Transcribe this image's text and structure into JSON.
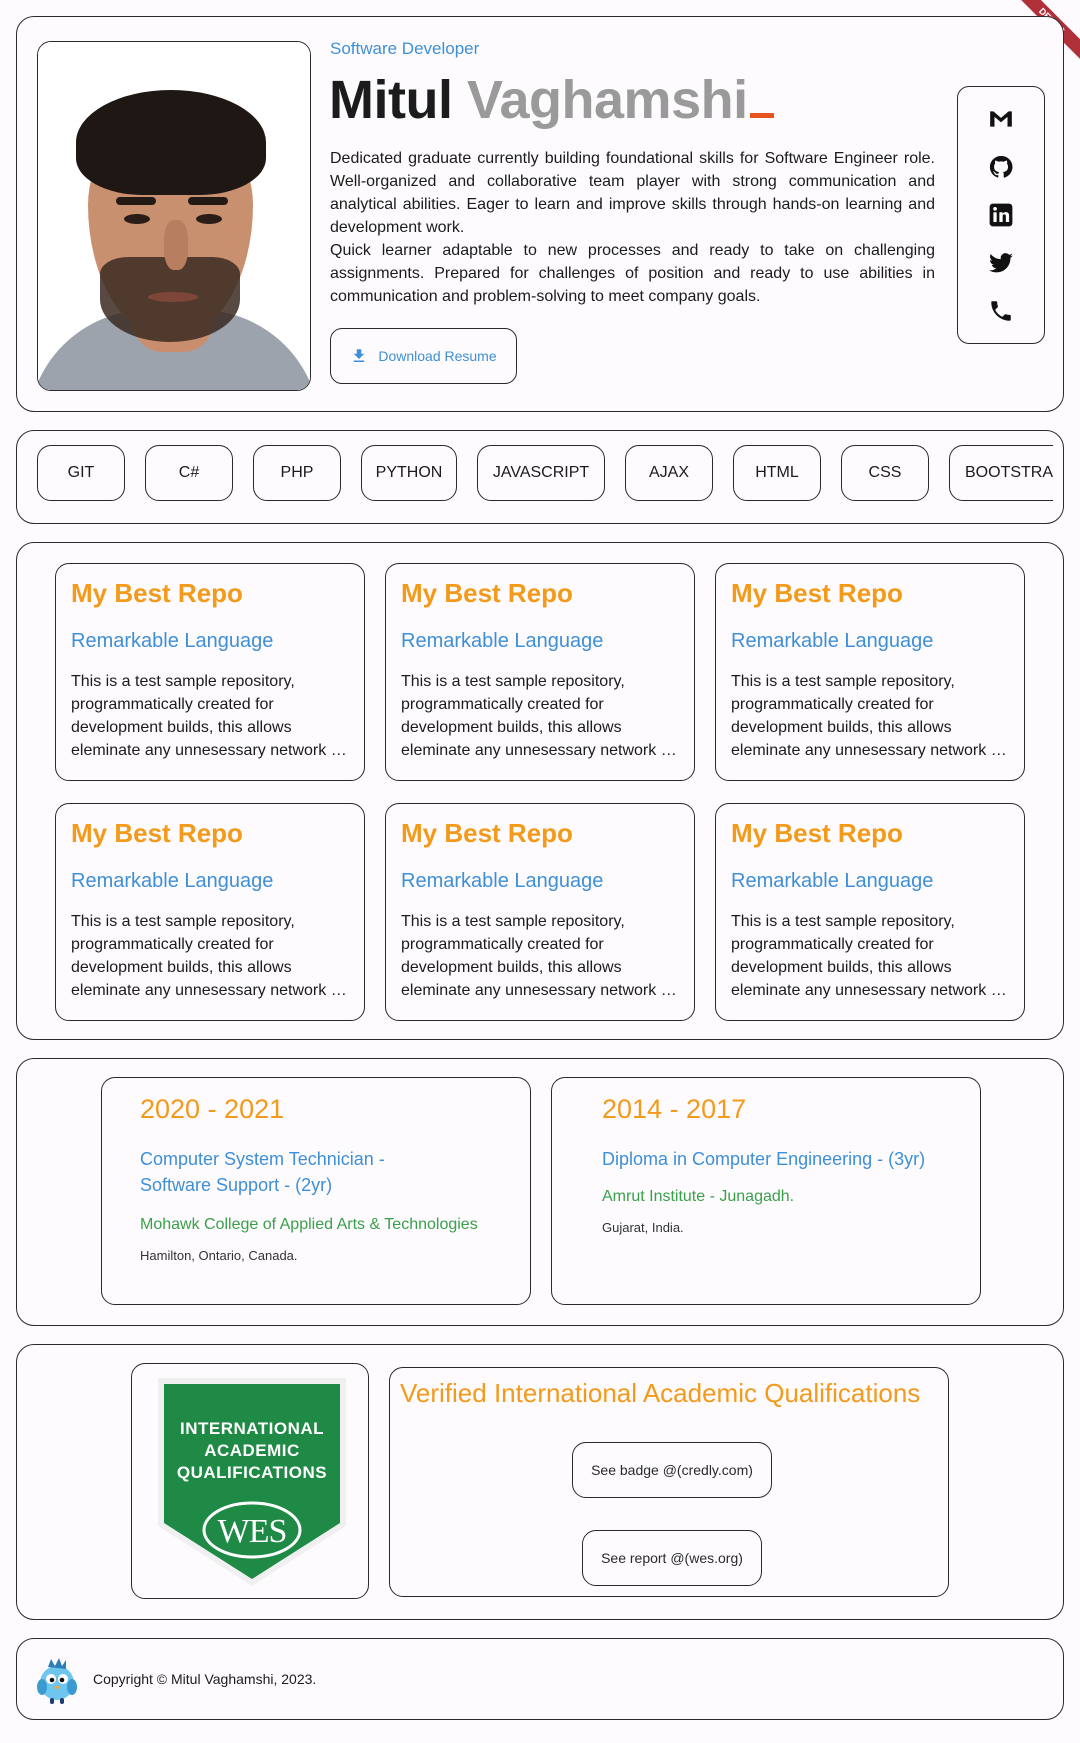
{
  "debug_banner": "DEBUG",
  "hero": {
    "role": "Software Developer",
    "first_name": "Mitul",
    "last_name": "Vaghamshi",
    "bio_1": "Dedicated graduate currently building foundational skills for Software Engineer role. Well-organized and collaborative team player with strong communication and analytical abilities. Eager to learn and improve skills through hands-on learning and development work.",
    "bio_2": "Quick learner adaptable to new processes and ready to take on challenging assignments. Prepared for challenges of position and ready to use abilities in communication and problem-solving to meet company goals.",
    "download_label": "Download Resume"
  },
  "social": [
    {
      "icon": "gmail-icon"
    },
    {
      "icon": "github-icon"
    },
    {
      "icon": "linkedin-icon"
    },
    {
      "icon": "twitter-icon"
    },
    {
      "icon": "phone-icon"
    }
  ],
  "skills": [
    "GIT",
    "C#",
    "PHP",
    "PYTHON",
    "JAVASCRIPT",
    "AJAX",
    "HTML",
    "CSS",
    "BOOTSTRAP"
  ],
  "repos": [
    {
      "title": "My Best Repo",
      "language": "Remarkable Language",
      "description": "This is a test sample repository, programmatically created for development builds, this allows eleminate any unnesessary network …"
    },
    {
      "title": "My Best Repo",
      "language": "Remarkable Language",
      "description": "This is a test sample repository, programmatically created for development builds, this allows eleminate any unnesessary network …"
    },
    {
      "title": "My Best Repo",
      "language": "Remarkable Language",
      "description": "This is a test sample repository, programmatically created for development builds, this allows eleminate any unnesessary network …"
    },
    {
      "title": "My Best Repo",
      "language": "Remarkable Language",
      "description": "This is a test sample repository, programmatically created for development builds, this allows eleminate any unnesessary network …"
    },
    {
      "title": "My Best Repo",
      "language": "Remarkable Language",
      "description": "This is a test sample repository, programmatically created for development builds, this allows eleminate any unnesessary network …"
    },
    {
      "title": "My Best Repo",
      "language": "Remarkable Language",
      "description": "This is a test sample repository, programmatically created for development builds, this allows eleminate any unnesessary network …"
    }
  ],
  "education": [
    {
      "years": "2020 - 2021",
      "degree": "Computer System Technician - Software Support - (2yr)",
      "school": "Mohawk College of Applied Arts & Technologies",
      "location": "Hamilton, Ontario, Canada."
    },
    {
      "years": "2014 - 2017",
      "degree": "Diploma in Computer Engineering - (3yr)",
      "school": "Amrut Institute - Junagadh.",
      "location": "Gujarat, India."
    }
  ],
  "credential": {
    "badge_line_1": "INTERNATIONAL",
    "badge_line_2": "ACADEMIC",
    "badge_line_3": "QUALIFICATIONS",
    "badge_logo": "WES",
    "title": "Verified International Academic Qualifications",
    "badge_link": "See badge @(credly.com)",
    "report_link": "See report @(wes.org)"
  },
  "footer": {
    "copyright": "Copyright © Mitul Vaghamshi, 2023.",
    "mascot_icon": "bird-mascot-icon"
  },
  "colors": {
    "accent_orange": "#f39a1b",
    "accent_blue": "#3f8fd6",
    "accent_green": "#3aa04a",
    "badge_green": "#1f8a45",
    "cursor_red": "#e8541f"
  }
}
